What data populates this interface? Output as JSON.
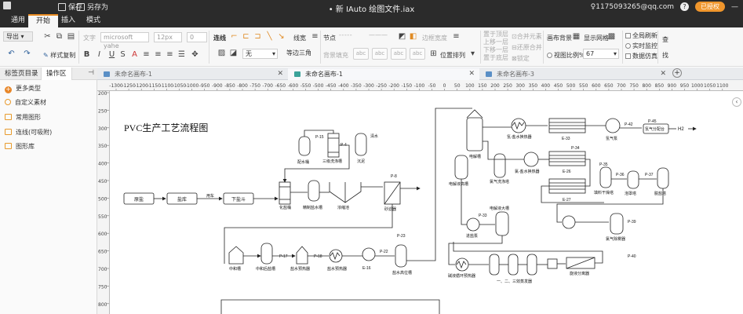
{
  "window": {
    "title": "• 新 IAuto 绘图文件.iax",
    "quick_access": {
      "save": "保存",
      "save_as": "另存为"
    },
    "account": "1175093265@qq.com",
    "auth_button": "已授权"
  },
  "menu": {
    "tabs": [
      "通用",
      "开始",
      "插入",
      "模式"
    ],
    "active": 1
  },
  "ribbon": {
    "export": "导出",
    "font_label": "文字",
    "font_family": "microsoft yahe",
    "font_size": "12px",
    "font_size2": "0",
    "format_painter": "样式复制",
    "connector": "连线",
    "line_label": "线宽",
    "node_label": "节点",
    "border_width": "边框宽度",
    "none": "无",
    "line_style": "等边三角",
    "bg_fill": "背景填充",
    "chip": "abc",
    "position": "位置排列",
    "bring_top": "置于顶层",
    "move_up": "上移一层",
    "move_down": "下移一层",
    "send_bottom": "置于底层",
    "merge": "合并元素",
    "restore_merge": "还原合并",
    "lock": "锁定",
    "canvas_bg": "画布背景",
    "show_grid": "显示网格",
    "view_scale": "视图比例%",
    "zoom": "67",
    "auto_refresh": "全局刷新",
    "live_monitor": "实时监控",
    "data_sim": "数据仿真",
    "search": "查",
    "replace": "找"
  },
  "panel": {
    "tabs": [
      "标签页目录",
      "操作区"
    ],
    "items": [
      "更多类型",
      "自定义素材",
      "常用图形",
      "连线(可吸附)",
      "图形库"
    ]
  },
  "doc_tabs": [
    "未命名画布-1",
    "未命名画布-1",
    "未命名画布-3"
  ],
  "ruler": {
    "h": [
      "-1300",
      "-1250",
      "-1200",
      "-1150",
      "-1100",
      "-1050",
      "-1000",
      "-950",
      "-900",
      "-850",
      "-800",
      "-750",
      "-700",
      "-650",
      "-600",
      "-550",
      "-500",
      "-450",
      "-400",
      "-350",
      "-300",
      "-250",
      "-200",
      "-150",
      "-100",
      "-50",
      "0",
      "50",
      "100",
      "150",
      "200",
      "250",
      "300",
      "350",
      "400",
      "450",
      "500",
      "550",
      "600",
      "650",
      "700",
      "750",
      "800",
      "850",
      "900",
      "950",
      "1000",
      "1050",
      "1100"
    ],
    "v": [
      "200",
      "250",
      "300",
      "350",
      "400",
      "450",
      "500",
      "550",
      "600",
      "650",
      "700",
      "750",
      "800"
    ]
  },
  "diagram": {
    "title": "PVC生产工艺流程图",
    "blocks": [
      "原盐",
      "盐库",
      "下盐斗"
    ],
    "labels": {
      "salt_car": "用车",
      "salt_tank": "化盐桶",
      "p15": "P-15",
      "salt_hopper": "配水桶",
      "three_stage": "三级洗涤槽",
      "p4": "P-4",
      "clarifier": "澄清桶",
      "settler": "沉泥",
      "settler_top": "清水",
      "refined": "精制盐水槽",
      "thickener": "浓缩池",
      "p8": "P-8",
      "sand_filter": "砂滤器",
      "p23": "P-23",
      "neutral": "中和槽",
      "p17": "P-17",
      "neutral_tank": "中和后盐槽",
      "p18": "P-18",
      "salt_preheat": "盐水预热器",
      "pre_heat": "盐水预热器",
      "e16": "E-16",
      "p22": "P-22",
      "hi_tank": "盐水高位槽",
      "electrolyzer": "电解槽",
      "h_cooler": "氢-盐水换热器",
      "e33": "E-33",
      "h_pump": "氢气泵",
      "p42": "P-42",
      "p45": "P-45",
      "h_sep": "氢气分配台",
      "h2": "H2",
      "chlorine_sep": "电解液高槽",
      "cl_cooler": "氯气洗涤塔",
      "cl_exch": "氯-盐水换热器",
      "p34": "P-34",
      "e26": "E-26",
      "e27": "E-27",
      "p35": "P-35",
      "p36": "P-36",
      "p37": "P-37",
      "dryer": "填料干燥塔",
      "compressor": "泡罩塔",
      "dehydrator": "脱盐塔",
      "p33": "P-33",
      "elec_high": "电解液大槽",
      "elec_pump": "进盐泵",
      "p39": "P-39",
      "cl_sep": "氯气除雾器",
      "p40": "P-40",
      "cond_preheat": "碱液循环预热器",
      "triple_eff": "一、二、三效蒸发器",
      "spin_sep": "旋液分离器"
    }
  }
}
